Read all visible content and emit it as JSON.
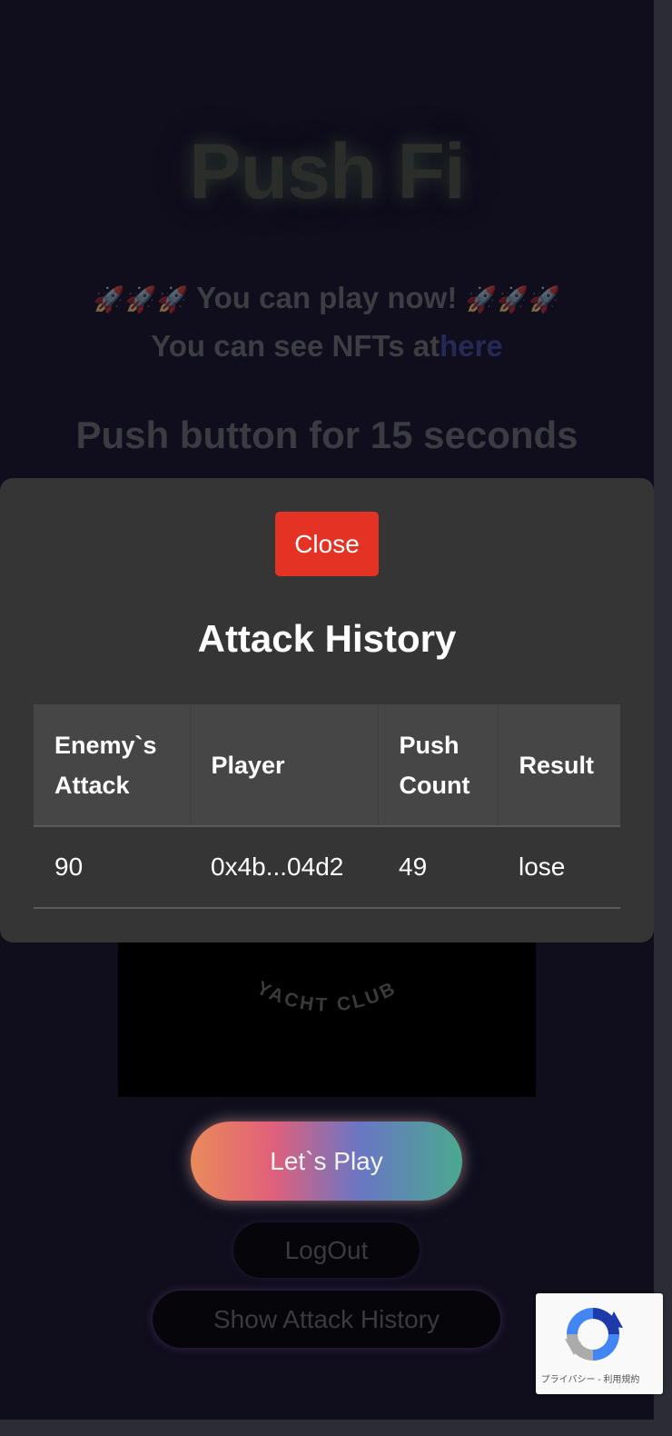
{
  "app": {
    "title": "Push Fi",
    "status_text": "You can play now!",
    "rocket_glyphs": "🚀🚀🚀",
    "nft_prefix": "You can see NFTs at",
    "nft_link_text": "here",
    "instruction": "Push button for 15 seconds",
    "nft_caption": "YACHT CLUB"
  },
  "buttons": {
    "play_label": "Let`s Play",
    "logout_label": "LogOut",
    "show_history_label": "Show Attack History"
  },
  "modal": {
    "close_label": "Close",
    "title": "Attack History",
    "columns": {
      "enemy_attack": "Enemy`s Attack",
      "player": "Player",
      "push_count": "Push Count",
      "result": "Result"
    },
    "rows": [
      {
        "enemy_attack": "90",
        "player": "0x4b...04d2",
        "push_count": "49",
        "result": "lose"
      }
    ]
  },
  "recaptcha": {
    "footer_text": "プライバシー - 利用規約",
    "icon": "recaptcha-icon"
  },
  "colors": {
    "background": "#100d1c",
    "modal_background": "#353535",
    "close_button": "#e43324",
    "table_header": "#464646"
  }
}
